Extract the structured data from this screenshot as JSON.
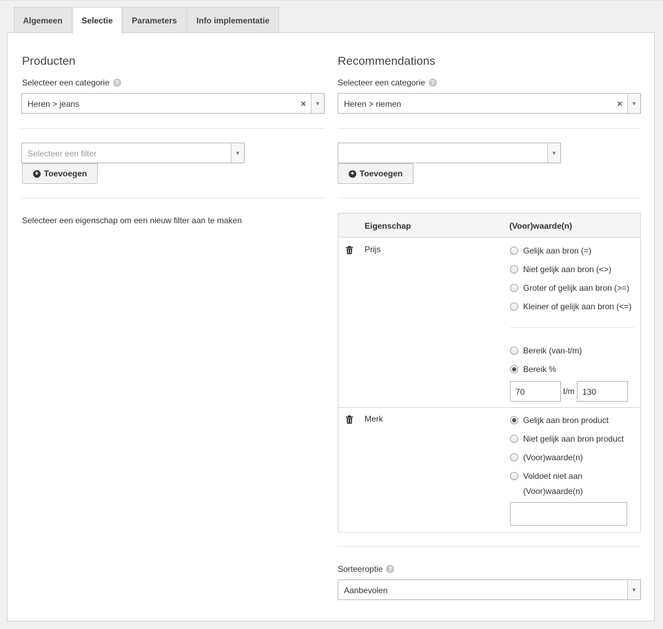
{
  "tabs": [
    {
      "label": "Algemeen"
    },
    {
      "label": "Selectie"
    },
    {
      "label": "Parameters"
    },
    {
      "label": "Info implementatie"
    }
  ],
  "left": {
    "title": "Producten",
    "category_label": "Selecteer een categorie",
    "category_value": "Heren > jeans",
    "filter_placeholder": "Selecteer een filter",
    "add_button": "Toevoegen",
    "hint": "Selecteer een eigenschap om een nieuw filter aan te maken"
  },
  "right": {
    "title": "Recommendations",
    "category_label": "Selecteer een categorie",
    "category_value": "Heren > riemen",
    "filter_value": "",
    "add_button": "Toevoegen",
    "table": {
      "col_property": "Eigenschap",
      "col_value": "(Voor)waarde(n)",
      "rows": [
        {
          "property": "Prijs",
          "options": [
            "Gelijk aan bron (=)",
            "Niet gelijk aan bron (<>)",
            "Groter of gelijk aan bron (>=)",
            "Kleiner of gelijk aan bron (<=)"
          ],
          "range_options": [
            "Bereik (van-t/m)",
            "Bereik %"
          ],
          "selected": "Bereik %",
          "range_from": "70",
          "range_sep": "t/m",
          "range_to": "130"
        },
        {
          "property": "Merk",
          "options": [
            "Gelijk aan bron product",
            "Niet gelijk aan bron product",
            "(Voor)waarde(n)",
            "Voldoet niet aan",
            "(Voor)waarde(n)"
          ],
          "selected": "Gelijk aan bron product",
          "value": ""
        }
      ]
    },
    "sort_label": "Sorteeroptie",
    "sort_value": "Aanbevolen"
  },
  "icons": {
    "help": "?",
    "clear": "×",
    "dropdown": "▼",
    "plus": "+"
  }
}
